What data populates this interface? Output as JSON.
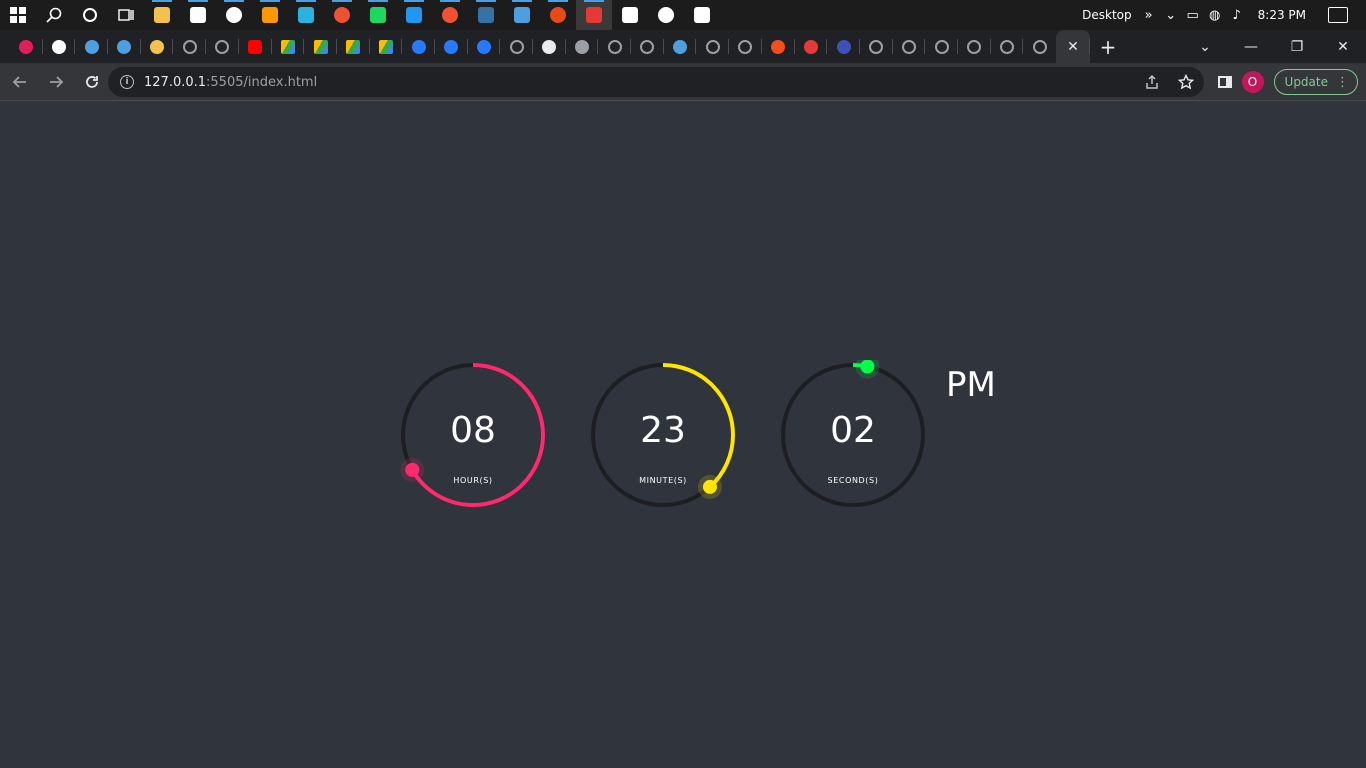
{
  "taskbar": {
    "apps": [
      {
        "icon": "windows-start-icon",
        "color": "#ffffff"
      },
      {
        "icon": "search-icon",
        "color": "#ffffff"
      },
      {
        "icon": "cortana-icon",
        "color": "#ffffff"
      },
      {
        "icon": "task-view-icon",
        "color": "#ffffff"
      },
      {
        "icon": "file-explorer-icon",
        "color": "#f2c14e"
      },
      {
        "icon": "store-icon",
        "color": "#ffffff"
      },
      {
        "icon": "mail-icon",
        "color": "#ffffff"
      },
      {
        "icon": "sublime-text-icon",
        "color": "#ff9800"
      },
      {
        "icon": "edge-icon",
        "color": "#2bb3e0"
      },
      {
        "icon": "git-icon",
        "color": "#f05033"
      },
      {
        "icon": "spotify-icon",
        "color": "#1ed760"
      },
      {
        "icon": "vscode-icon",
        "color": "#2196f3"
      },
      {
        "icon": "git-kraken-icon",
        "color": "#f05033"
      },
      {
        "icon": "python-icon",
        "color": "#3572a5"
      },
      {
        "icon": "browser-icon",
        "color": "#4d9fe0"
      },
      {
        "icon": "mockup-icon",
        "color": "#e64a19"
      },
      {
        "icon": "chrome-icon",
        "color": "#e53935"
      },
      {
        "icon": "target-icon",
        "color": "#ffffff"
      },
      {
        "icon": "settings-icon",
        "color": "#ffffff"
      },
      {
        "icon": "usb-icon",
        "color": "#ffffff"
      }
    ],
    "tray": {
      "desktop_label": "Desktop",
      "chevron": "»",
      "time": "8:23 PM"
    }
  },
  "browser": {
    "tabs": [
      {
        "icon": "slack-icon",
        "color": "#e01e5a"
      },
      {
        "icon": "github-icon",
        "color": "#ffffff"
      },
      {
        "icon": "target-icon",
        "color": "#4d9fe0"
      },
      {
        "icon": "target-icon",
        "color": "#4d9fe0"
      },
      {
        "icon": "wb-icon",
        "color": "#f2c14e"
      },
      {
        "icon": "globe-icon",
        "color": "#9aa0a6"
      },
      {
        "icon": "globe-icon",
        "color": "#9aa0a6"
      },
      {
        "icon": "youtube-icon",
        "color": "#ff0000"
      },
      {
        "icon": "drive-icon",
        "color": "#34a853"
      },
      {
        "icon": "drive-icon",
        "color": "#34a853"
      },
      {
        "icon": "drive-icon",
        "color": "#34a853"
      },
      {
        "icon": "drive-icon",
        "color": "#34a853"
      },
      {
        "icon": "bot-icon",
        "color": "#2979ff"
      },
      {
        "icon": "bot-icon",
        "color": "#2979ff"
      },
      {
        "icon": "bot-icon",
        "color": "#2979ff"
      },
      {
        "icon": "globe-icon",
        "color": "#9aa0a6"
      },
      {
        "icon": "history-icon",
        "color": "#e8eaed"
      },
      {
        "icon": "wb-icon",
        "color": "#9aa0a6"
      },
      {
        "icon": "globe-icon",
        "color": "#9aa0a6"
      },
      {
        "icon": "globe-icon",
        "color": "#9aa0a6"
      },
      {
        "icon": "browser-icon",
        "color": "#4d9fe0"
      },
      {
        "icon": "globe-icon",
        "color": "#9aa0a6"
      },
      {
        "icon": "globe-icon",
        "color": "#9aa0a6"
      },
      {
        "icon": "figma-icon",
        "color": "#f24e1e"
      },
      {
        "icon": "info-icon",
        "color": "#e53935"
      },
      {
        "icon": "shield-icon",
        "color": "#3f51b5"
      },
      {
        "icon": "globe-icon",
        "color": "#9aa0a6"
      },
      {
        "icon": "globe-icon",
        "color": "#9aa0a6"
      },
      {
        "icon": "globe-icon",
        "color": "#9aa0a6"
      },
      {
        "icon": "globe-icon",
        "color": "#9aa0a6"
      },
      {
        "icon": "globe-icon",
        "color": "#9aa0a6"
      },
      {
        "icon": "globe-icon",
        "color": "#9aa0a6"
      }
    ],
    "close_glyph": "✕",
    "newtab_glyph": "+",
    "window_controls": {
      "dropdown": "⌄",
      "minimize": "—",
      "restore": "❐",
      "close": "✕"
    },
    "url_host": "127.0.0.1",
    "url_path": ":5505/index.html",
    "profile_initial": "O",
    "update_label": "Update"
  },
  "clock": {
    "hours": {
      "value": "08",
      "label": "HOUR(S)",
      "color": "#ff2a6d",
      "progress": 0.667
    },
    "minutes": {
      "value": "23",
      "label": "MINUTE(S)",
      "color": "#ffe500",
      "progress": 0.383
    },
    "seconds": {
      "value": "02",
      "label": "SECOND(S)",
      "color": "#04ff48",
      "progress": 0.033
    },
    "ampm": "PM",
    "track_color": "#1c1e22"
  }
}
